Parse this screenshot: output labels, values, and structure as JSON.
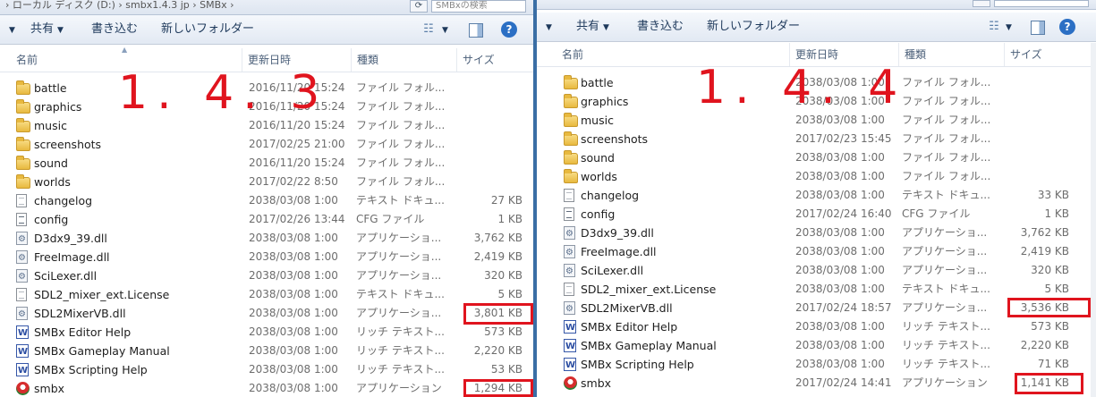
{
  "left": {
    "address_path": "› ローカル ディスク (D:) › smbx1.4.3 jp › SMBx ›",
    "search_placeholder": "SMBxの検索",
    "toolbar": {
      "share": "共有",
      "burn": "書き込む",
      "new_folder": "新しいフォルダー"
    },
    "columns": {
      "name": "名前",
      "date": "更新日時",
      "type": "種類",
      "size": "サイズ"
    },
    "version_label": "1. 4. 3",
    "rows": [
      {
        "name": "battle",
        "date": "2016/11/20 15:24",
        "type": "ファイル フォル...",
        "size": "",
        "icon": "folder-icon"
      },
      {
        "name": "graphics",
        "date": "2016/11/20 15:24",
        "type": "ファイル フォル...",
        "size": "",
        "icon": "folder-icon"
      },
      {
        "name": "music",
        "date": "2016/11/20 15:24",
        "type": "ファイル フォル...",
        "size": "",
        "icon": "folder-icon"
      },
      {
        "name": "screenshots",
        "date": "2017/02/25 21:00",
        "type": "ファイル フォル...",
        "size": "",
        "icon": "folder-icon"
      },
      {
        "name": "sound",
        "date": "2016/11/20 15:24",
        "type": "ファイル フォル...",
        "size": "",
        "icon": "folder-icon"
      },
      {
        "name": "worlds",
        "date": "2017/02/22 8:50",
        "type": "ファイル フォル...",
        "size": "",
        "icon": "folder-icon"
      },
      {
        "name": "changelog",
        "date": "2038/03/08 1:00",
        "type": "テキスト ドキュ...",
        "size": "27 KB",
        "icon": "text-file-icon"
      },
      {
        "name": "config",
        "date": "2017/02/26 13:44",
        "type": "CFG ファイル",
        "size": "1 KB",
        "icon": "config-file-icon"
      },
      {
        "name": "D3dx9_39.dll",
        "date": "2038/03/08 1:00",
        "type": "アプリケーショ...",
        "size": "3,762 KB",
        "icon": "dll-file-icon"
      },
      {
        "name": "FreeImage.dll",
        "date": "2038/03/08 1:00",
        "type": "アプリケーショ...",
        "size": "2,419 KB",
        "icon": "dll-file-icon"
      },
      {
        "name": "SciLexer.dll",
        "date": "2038/03/08 1:00",
        "type": "アプリケーショ...",
        "size": "320 KB",
        "icon": "dll-file-icon"
      },
      {
        "name": "SDL2_mixer_ext.License",
        "date": "2038/03/08 1:00",
        "type": "テキスト ドキュ...",
        "size": "5 KB",
        "icon": "text-file-icon"
      },
      {
        "name": "SDL2MixerVB.dll",
        "date": "2038/03/08 1:00",
        "type": "アプリケーショ...",
        "size": "3,801 KB",
        "icon": "dll-file-icon"
      },
      {
        "name": "SMBx Editor Help",
        "date": "2038/03/08 1:00",
        "type": "リッチ テキスト...",
        "size": "573 KB",
        "icon": "rich-text-file-icon"
      },
      {
        "name": "SMBx Gameplay Manual",
        "date": "2038/03/08 1:00",
        "type": "リッチ テキスト...",
        "size": "2,220 KB",
        "icon": "rich-text-file-icon"
      },
      {
        "name": "SMBx Scripting Help",
        "date": "2038/03/08 1:00",
        "type": "リッチ テキスト...",
        "size": "53 KB",
        "icon": "rich-text-file-icon"
      },
      {
        "name": "smbx",
        "date": "2038/03/08 1:00",
        "type": "アプリケーション",
        "size": "1,294 KB",
        "icon": "smbx-app-icon"
      }
    ]
  },
  "right": {
    "toolbar": {
      "share": "共有",
      "burn": "書き込む",
      "new_folder": "新しいフォルダー"
    },
    "columns": {
      "name": "名前",
      "date": "更新日時",
      "type": "種類",
      "size": "サイズ"
    },
    "version_label": "1. 4. 4",
    "rows": [
      {
        "name": "battle",
        "date": "2038/03/08 1:00",
        "type": "ファイル フォル...",
        "size": "",
        "icon": "folder-icon"
      },
      {
        "name": "graphics",
        "date": "2038/03/08 1:00",
        "type": "ファイル フォル...",
        "size": "",
        "icon": "folder-icon"
      },
      {
        "name": "music",
        "date": "2038/03/08 1:00",
        "type": "ファイル フォル...",
        "size": "",
        "icon": "folder-icon"
      },
      {
        "name": "screenshots",
        "date": "2017/02/23 15:45",
        "type": "ファイル フォル...",
        "size": "",
        "icon": "folder-icon"
      },
      {
        "name": "sound",
        "date": "2038/03/08 1:00",
        "type": "ファイル フォル...",
        "size": "",
        "icon": "folder-icon"
      },
      {
        "name": "worlds",
        "date": "2038/03/08 1:00",
        "type": "ファイル フォル...",
        "size": "",
        "icon": "folder-icon"
      },
      {
        "name": "changelog",
        "date": "2038/03/08 1:00",
        "type": "テキスト ドキュ...",
        "size": "33 KB",
        "icon": "text-file-icon"
      },
      {
        "name": "config",
        "date": "2017/02/24 16:40",
        "type": "CFG ファイル",
        "size": "1 KB",
        "icon": "config-file-icon"
      },
      {
        "name": "D3dx9_39.dll",
        "date": "2038/03/08 1:00",
        "type": "アプリケーショ...",
        "size": "3,762 KB",
        "icon": "dll-file-icon"
      },
      {
        "name": "FreeImage.dll",
        "date": "2038/03/08 1:00",
        "type": "アプリケーショ...",
        "size": "2,419 KB",
        "icon": "dll-file-icon"
      },
      {
        "name": "SciLexer.dll",
        "date": "2038/03/08 1:00",
        "type": "アプリケーショ...",
        "size": "320 KB",
        "icon": "dll-file-icon"
      },
      {
        "name": "SDL2_mixer_ext.License",
        "date": "2038/03/08 1:00",
        "type": "テキスト ドキュ...",
        "size": "5 KB",
        "icon": "text-file-icon"
      },
      {
        "name": "SDL2MixerVB.dll",
        "date": "2017/02/24 18:57",
        "type": "アプリケーショ...",
        "size": "3,536 KB",
        "icon": "dll-file-icon"
      },
      {
        "name": "SMBx Editor Help",
        "date": "2038/03/08 1:00",
        "type": "リッチ テキスト...",
        "size": "573 KB",
        "icon": "rich-text-file-icon"
      },
      {
        "name": "SMBx Gameplay Manual",
        "date": "2038/03/08 1:00",
        "type": "リッチ テキスト...",
        "size": "2,220 KB",
        "icon": "rich-text-file-icon"
      },
      {
        "name": "SMBx Scripting Help",
        "date": "2038/03/08 1:00",
        "type": "リッチ テキスト...",
        "size": "71 KB",
        "icon": "rich-text-file-icon"
      },
      {
        "name": "smbx",
        "date": "2017/02/24 14:41",
        "type": "アプリケーション",
        "size": "1,141 KB",
        "icon": "smbx-app-icon"
      }
    ]
  },
  "colors": {
    "annotation": "#e0141e",
    "toolbar_text": "#1e395b",
    "divider": "#3a6ea5"
  }
}
